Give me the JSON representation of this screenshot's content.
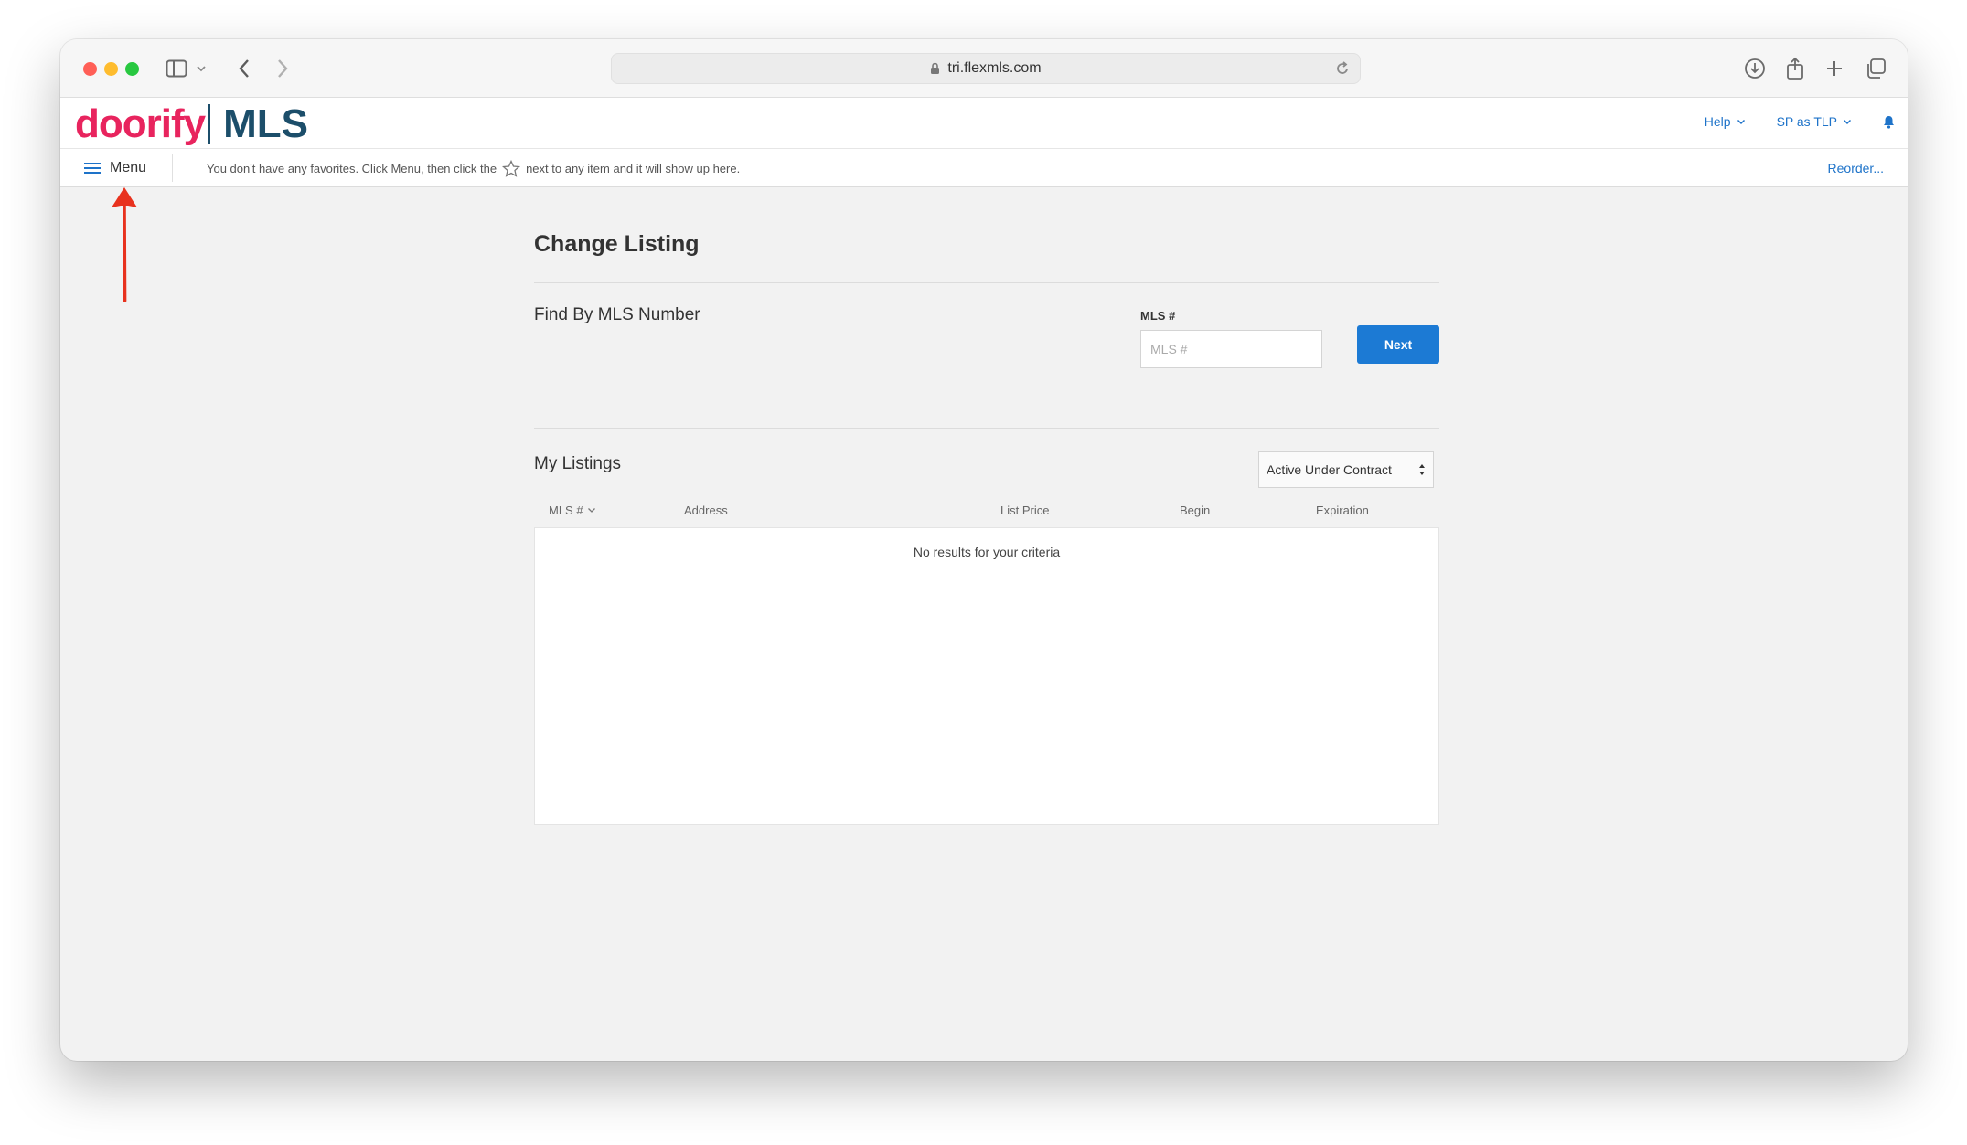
{
  "browser": {
    "url": "tri.flexmls.com"
  },
  "header": {
    "logo_primary": "doorify",
    "logo_secondary": "MLS",
    "help_label": "Help",
    "user_label": "SP as TLP"
  },
  "favorites_bar": {
    "menu_label": "Menu",
    "message_before": "You don't have any favorites. Click Menu, then click the",
    "message_after": "next to any item and it will show up here.",
    "reorder_label": "Reorder..."
  },
  "main": {
    "title": "Change Listing",
    "find_section": {
      "heading": "Find By MLS Number",
      "field_label": "MLS #",
      "field_placeholder": "MLS #",
      "field_value": "",
      "next_label": "Next"
    },
    "listings_section": {
      "heading": "My Listings",
      "status_filter": "Active Under Contract",
      "columns": [
        "MLS #",
        "Address",
        "List Price",
        "Begin",
        "Expiration"
      ],
      "rows": [],
      "empty_message": "No results for your criteria"
    }
  },
  "colors": {
    "brand_pink": "#e8245e",
    "brand_navy": "#1c4e6a",
    "link_blue": "#1e73c9",
    "button_blue": "#1c7ad4",
    "annotation_red": "#e8321e"
  }
}
